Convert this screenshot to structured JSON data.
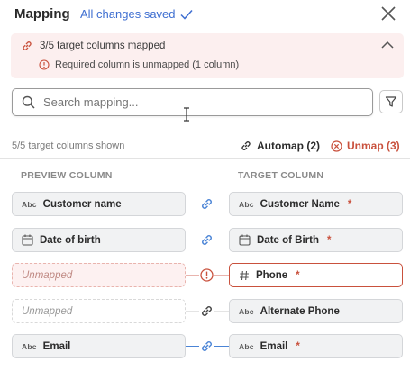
{
  "header": {
    "title": "Mapping",
    "saved_label": "All changes saved"
  },
  "banner": {
    "summary": "3/5 target columns mapped",
    "warning": "Required column is unmapped (1 column)"
  },
  "search": {
    "placeholder": "Search mapping..."
  },
  "toolbar": {
    "shown_label": "5/5 target columns shown",
    "automap_label": "Automap (2)",
    "unmap_label": "Unmap (3)"
  },
  "columns": {
    "preview_header": "PREVIEW COLUMN",
    "target_header": "TARGET COLUMN"
  },
  "type_badge": "Abc",
  "required_mark": "*",
  "rows": [
    {
      "preview": "Customer name",
      "preview_icon": "text-type-icon",
      "target": "Customer Name",
      "target_icon": "text-type-icon",
      "required": true,
      "status": "mapped"
    },
    {
      "preview": "Date of birth",
      "preview_icon": "calendar-icon",
      "target": "Date of Birth",
      "target_icon": "calendar-icon",
      "required": true,
      "status": "mapped"
    },
    {
      "preview": "Unmapped",
      "preview_icon": "",
      "target": "Phone",
      "target_icon": "hash-icon",
      "required": true,
      "status": "required-unmapped"
    },
    {
      "preview": "Unmapped",
      "preview_icon": "",
      "target": "Alternate Phone",
      "target_icon": "text-type-icon",
      "required": false,
      "status": "unmapped"
    },
    {
      "preview": "Email",
      "preview_icon": "text-type-icon",
      "target": "Email",
      "target_icon": "text-type-icon",
      "required": true,
      "status": "mapped"
    }
  ],
  "colors": {
    "accent": "#3f6fd1",
    "link": "#4a84d6",
    "danger": "#c9513d",
    "banner_bg": "#fcefef"
  }
}
